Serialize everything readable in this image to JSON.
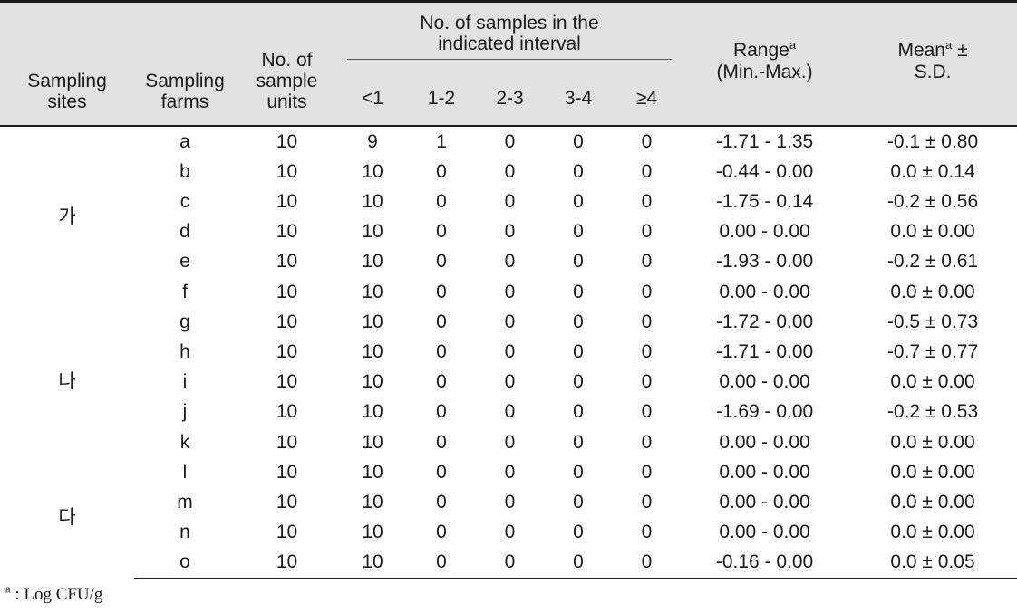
{
  "table": {
    "header": {
      "sampling_sites": "Sampling\nsites",
      "sampling_farms": "Sampling\nfarms",
      "sample_units": "No. of\nsample\nunits",
      "interval_group_title": "No. of samples in the\nindicated interval",
      "interval_subheaders": [
        "<1",
        "1-2",
        "2-3",
        "3-4",
        "≥4"
      ],
      "range_label": "Range",
      "range_sup": "a",
      "range_sub": "(Min.-Max.)",
      "mean_label": "Mean",
      "mean_sup": "a",
      "mean_pm": "±",
      "mean_sub": "S.D."
    },
    "columns": [
      "Sampling sites",
      "Sampling farms",
      "No. of sample units",
      "<1",
      "1-2",
      "2-3",
      "3-4",
      "≥4",
      "Range (Min.-Max.)",
      "Mean ± S.D."
    ],
    "sites": [
      {
        "label": "가",
        "farm_start": 0,
        "farm_count": 6
      },
      {
        "label": "나",
        "farm_start": 6,
        "farm_count": 5
      },
      {
        "label": "다",
        "farm_start": 11,
        "farm_count": 4
      }
    ],
    "rows": [
      {
        "site": "가",
        "farm": "a",
        "units": "10",
        "i_lt1": "9",
        "i_12": "1",
        "i_23": "0",
        "i_34": "0",
        "i_ge4": "0",
        "range": "-1.71 -  1.35",
        "mean": "-0.1 ± 0.80"
      },
      {
        "site": "가",
        "farm": "b",
        "units": "10",
        "i_lt1": "10",
        "i_12": "0",
        "i_23": "0",
        "i_34": "0",
        "i_ge4": "0",
        "range": "-0.44 -  0.00",
        "mean": "0.0 ± 0.14"
      },
      {
        "site": "가",
        "farm": "c",
        "units": "10",
        "i_lt1": "10",
        "i_12": "0",
        "i_23": "0",
        "i_34": "0",
        "i_ge4": "0",
        "range": "-1.75 -  0.14",
        "mean": "-0.2 ± 0.56"
      },
      {
        "site": "가",
        "farm": "d",
        "units": "10",
        "i_lt1": "10",
        "i_12": "0",
        "i_23": "0",
        "i_34": "0",
        "i_ge4": "0",
        "range": "0.00 -  0.00",
        "mean": "0.0 ± 0.00"
      },
      {
        "site": "가",
        "farm": "e",
        "units": "10",
        "i_lt1": "10",
        "i_12": "0",
        "i_23": "0",
        "i_34": "0",
        "i_ge4": "0",
        "range": "-1.93 -  0.00",
        "mean": "-0.2 ± 0.61"
      },
      {
        "site": "가",
        "farm": "f",
        "units": "10",
        "i_lt1": "10",
        "i_12": "0",
        "i_23": "0",
        "i_34": "0",
        "i_ge4": "0",
        "range": "0.00 -  0.00",
        "mean": "0.0 ± 0.00"
      },
      {
        "site": "나",
        "farm": "g",
        "units": "10",
        "i_lt1": "10",
        "i_12": "0",
        "i_23": "0",
        "i_34": "0",
        "i_ge4": "0",
        "range": "-1.72 -  0.00",
        "mean": "-0.5 ± 0.73"
      },
      {
        "site": "나",
        "farm": "h",
        "units": "10",
        "i_lt1": "10",
        "i_12": "0",
        "i_23": "0",
        "i_34": "0",
        "i_ge4": "0",
        "range": "-1.71 -  0.00",
        "mean": "-0.7 ± 0.77"
      },
      {
        "site": "나",
        "farm": "i",
        "units": "10",
        "i_lt1": "10",
        "i_12": "0",
        "i_23": "0",
        "i_34": "0",
        "i_ge4": "0",
        "range": "0.00 -  0.00",
        "mean": "0.0 ± 0.00"
      },
      {
        "site": "나",
        "farm": "j",
        "units": "10",
        "i_lt1": "10",
        "i_12": "0",
        "i_23": "0",
        "i_34": "0",
        "i_ge4": "0",
        "range": "-1.69 -  0.00",
        "mean": "-0.2 ± 0.53"
      },
      {
        "site": "나",
        "farm": "k",
        "units": "10",
        "i_lt1": "10",
        "i_12": "0",
        "i_23": "0",
        "i_34": "0",
        "i_ge4": "0",
        "range": "0.00 -  0.00",
        "mean": "0.0 ± 0.00"
      },
      {
        "site": "다",
        "farm": "l",
        "units": "10",
        "i_lt1": "10",
        "i_12": "0",
        "i_23": "0",
        "i_34": "0",
        "i_ge4": "0",
        "range": "0.00 -  0.00",
        "mean": "0.0 ± 0.00"
      },
      {
        "site": "다",
        "farm": "m",
        "units": "10",
        "i_lt1": "10",
        "i_12": "0",
        "i_23": "0",
        "i_34": "0",
        "i_ge4": "0",
        "range": "0.00 -  0.00",
        "mean": "0.0 ± 0.00"
      },
      {
        "site": "다",
        "farm": "n",
        "units": "10",
        "i_lt1": "10",
        "i_12": "0",
        "i_23": "0",
        "i_34": "0",
        "i_ge4": "0",
        "range": "0.00 -  0.00",
        "mean": "0.0 ± 0.00"
      },
      {
        "site": "다",
        "farm": "o",
        "units": "10",
        "i_lt1": "10",
        "i_12": "0",
        "i_23": "0",
        "i_34": "0",
        "i_ge4": "0",
        "range": "-0.16 -  0.00",
        "mean": "0.0 ± 0.05"
      }
    ],
    "footnote": {
      "sup": "a",
      "text": " :  Log  CFU/g"
    }
  },
  "colors": {
    "header_background": "#e2e2e2",
    "rule": "#1a1a1a",
    "text": "#1a1a1a",
    "page_background": "#ffffff"
  }
}
